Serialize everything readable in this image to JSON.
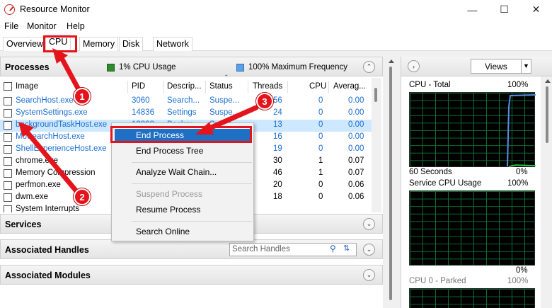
{
  "window": {
    "title": "Resource Monitor",
    "minimize": "—",
    "maximize": "☐",
    "close": "✕"
  },
  "menu": [
    "File",
    "Monitor",
    "Help"
  ],
  "tabs": [
    "Overview",
    "CPU",
    "Memory",
    "Disk",
    "Network"
  ],
  "processes": {
    "title": "Processes",
    "cpu_usage": "1% CPU Usage",
    "max_freq": "100% Maximum Frequency",
    "columns": [
      "Image",
      "PID",
      "Descrip...",
      "Status",
      "Threads",
      "CPU",
      "Averag..."
    ],
    "rows": [
      {
        "image": "SearchHost.exe",
        "pid": "3060",
        "desc": "Search...",
        "status": "Suspe...",
        "threads": "56",
        "cpu": "0",
        "avg": "0.00"
      },
      {
        "image": "SystemSettings.exe",
        "pid": "14836",
        "desc": "Settings",
        "status": "Suspe...",
        "threads": "24",
        "cpu": "0",
        "avg": "0.00"
      },
      {
        "image": "backgroundTaskHost.exe",
        "pid": "13868",
        "desc": "Backgr...",
        "status": "Suspe...",
        "threads": "13",
        "cpu": "0",
        "avg": "0.00"
      },
      {
        "image": "MoSearchHost.exe",
        "pid": "",
        "desc": "",
        "status": "",
        "threads": "16",
        "cpu": "0",
        "avg": "0.00"
      },
      {
        "image": "ShellExperienceHost.exe",
        "pid": "",
        "desc": "",
        "status": "",
        "threads": "19",
        "cpu": "0",
        "avg": "0.00"
      },
      {
        "image": "chrome.exe",
        "pid": "",
        "desc": "",
        "status": "",
        "threads": "30",
        "cpu": "1",
        "avg": "0.07"
      },
      {
        "image": "Memory Compression",
        "pid": "",
        "desc": "",
        "status": "",
        "threads": "46",
        "cpu": "1",
        "avg": "0.07"
      },
      {
        "image": "perfmon.exe",
        "pid": "",
        "desc": "",
        "status": "",
        "threads": "20",
        "cpu": "0",
        "avg": "0.06"
      },
      {
        "image": "dwm.exe",
        "pid": "",
        "desc": "",
        "status": "",
        "threads": "18",
        "cpu": "0",
        "avg": "0.06"
      },
      {
        "image": "System Interrupts",
        "pid": "",
        "desc": "",
        "status": "",
        "threads": "",
        "cpu": "",
        "avg": ""
      }
    ]
  },
  "context_menu": {
    "items": [
      "End Process",
      "End Process Tree",
      "Analyze Wait Chain...",
      "Suspend Process",
      "Resume Process",
      "Search Online"
    ]
  },
  "services": {
    "title": "Services"
  },
  "handles": {
    "title": "Associated Handles",
    "search_placeholder": "Search Handles"
  },
  "modules": {
    "title": "Associated Modules"
  },
  "right": {
    "views_label": "Views",
    "graph1_title": "CPU - Total",
    "graph1_max": "100%",
    "graph1_time": "60 Seconds",
    "graph1_min": "0%",
    "graph2_title": "Service CPU Usage",
    "graph2_max": "100%",
    "graph2_min": "0%",
    "graph3_title": "CPU 0 - Parked",
    "graph3_max": "100%"
  },
  "annotations": {
    "badge1": "1",
    "badge2": "2",
    "badge3": "3"
  },
  "colors": {
    "accent": "#1f6fc5",
    "annotation": "#e5131b",
    "cpu_legend": "#2e8b2e",
    "freq_legend": "#5aa0e6"
  }
}
